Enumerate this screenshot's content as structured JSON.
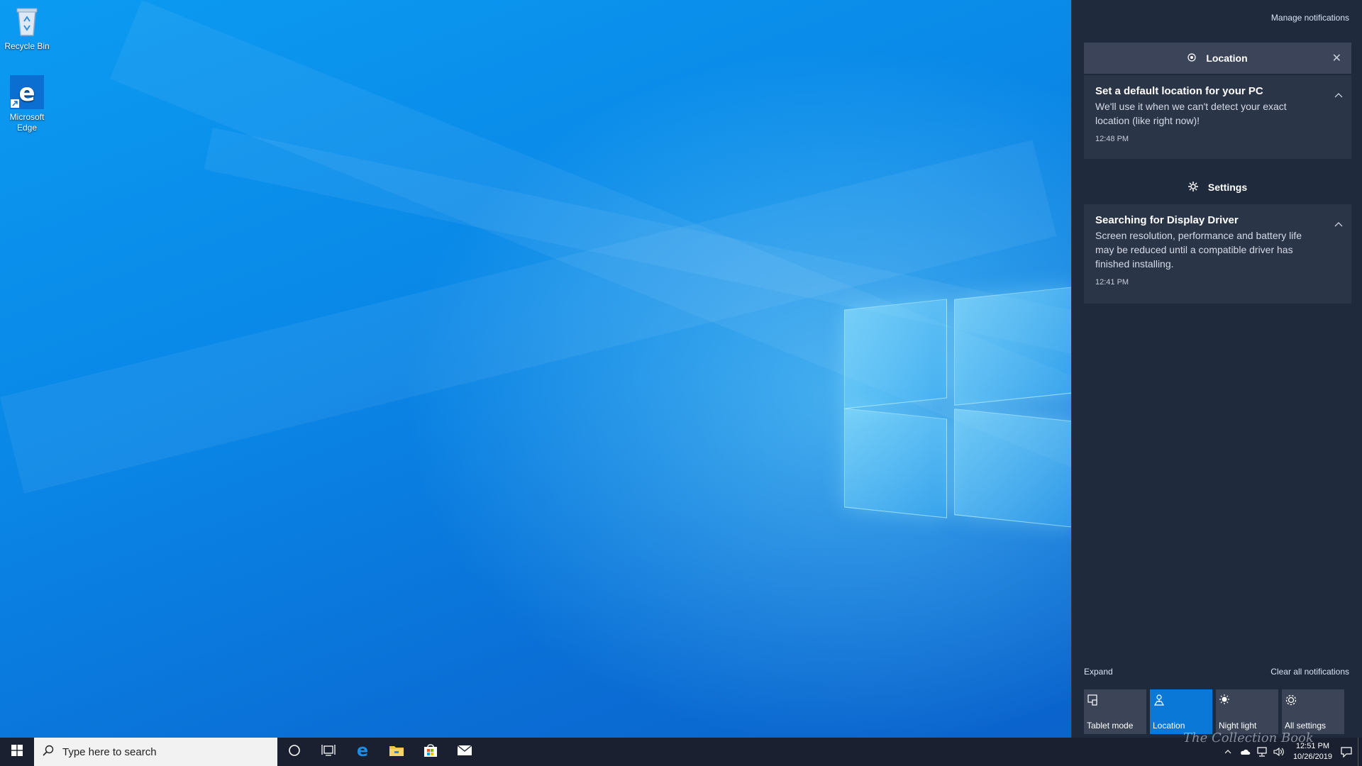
{
  "desktop": {
    "icons": [
      {
        "label": "Recycle Bin",
        "icon": "recycle-bin-icon"
      },
      {
        "label": "Microsoft Edge",
        "icon": "edge-icon"
      }
    ]
  },
  "action_center": {
    "manage_label": "Manage notifications",
    "groups": [
      {
        "name": "Location",
        "icon": "location-icon",
        "notifications": [
          {
            "title": "Set a default location for your PC",
            "body": "We'll use it when we can't detect your exact location (like right now)!",
            "time": "12:48 PM"
          }
        ]
      },
      {
        "name": "Settings",
        "icon": "gear-icon",
        "notifications": [
          {
            "title": "Searching for Display Driver",
            "body": "Screen resolution, performance and battery life may be reduced until a compatible driver has finished installing.",
            "time": "12:41 PM"
          }
        ]
      }
    ],
    "expand_label": "Expand",
    "clear_label": "Clear all notifications",
    "quick_actions": [
      {
        "label": "Tablet mode",
        "icon": "tablet-mode-icon",
        "active": false
      },
      {
        "label": "Location",
        "icon": "location-icon",
        "active": true
      },
      {
        "label": "Night light",
        "icon": "night-light-icon",
        "active": false
      },
      {
        "label": "All settings",
        "icon": "gear-icon",
        "active": false
      }
    ]
  },
  "taskbar": {
    "search_placeholder": "Type here to search",
    "pinned": [
      "cortana-icon",
      "task-view-icon",
      "edge-icon",
      "file-explorer-icon",
      "store-icon",
      "mail-icon"
    ],
    "clock_time": "12:51 PM",
    "clock_date": "10/26/2019",
    "watermark": "The Collection Book"
  },
  "colors": {
    "action_center_bg": "#1f2a3d",
    "notification_bg": "#2b3548",
    "active_tile": "#0a78d7",
    "taskbar_bg": "#1a2030"
  }
}
